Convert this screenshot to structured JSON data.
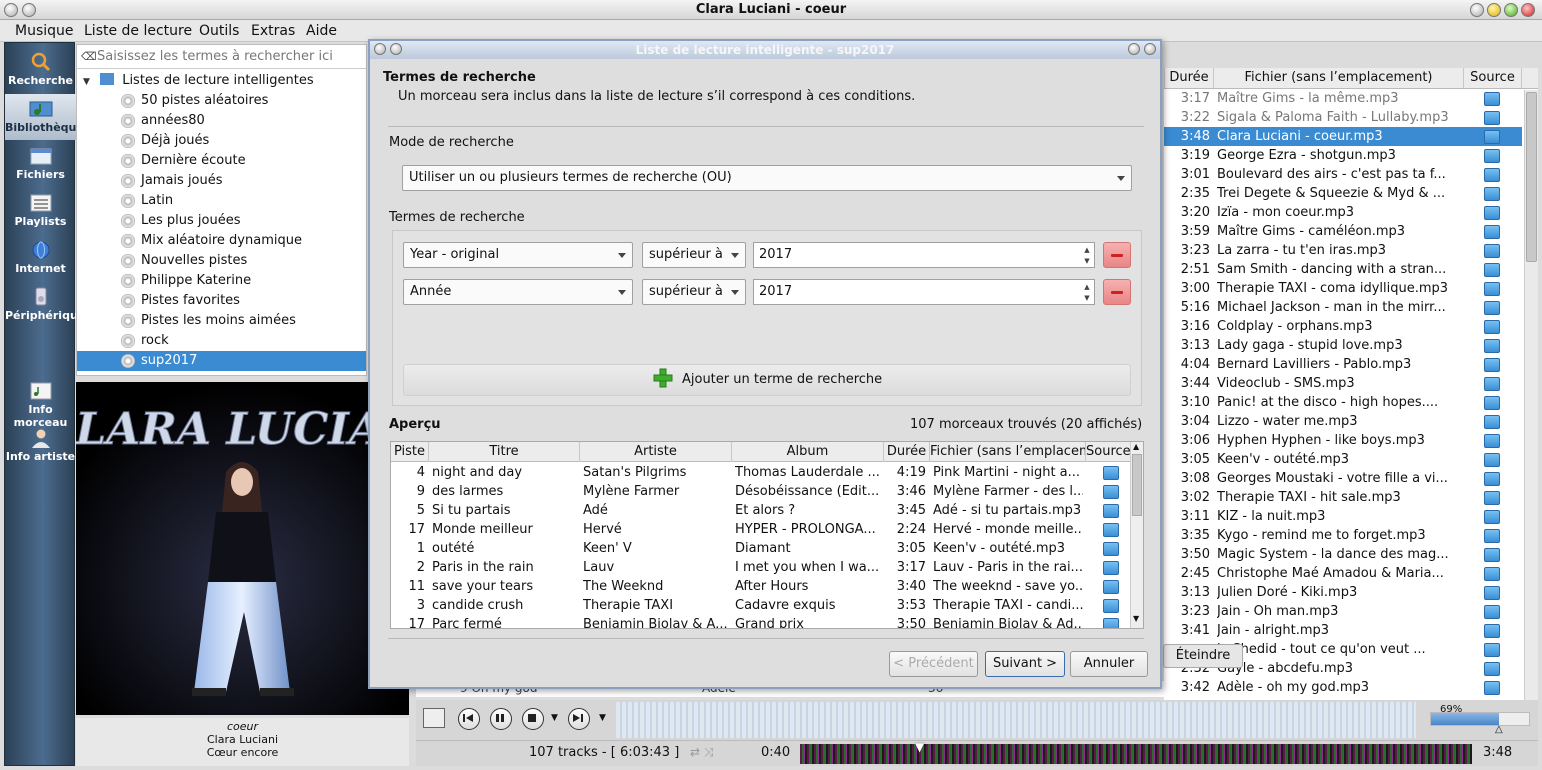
{
  "window": {
    "title": "Clara Luciani - coeur"
  },
  "menu": [
    "Musique",
    "Liste de lecture",
    "Outils",
    "Extras",
    "Aide"
  ],
  "nav": [
    {
      "label": "Recherche",
      "icon": "search-icon"
    },
    {
      "label": "Bibliothèque",
      "icon": "library-icon"
    },
    {
      "label": "Fichiers",
      "icon": "files-icon"
    },
    {
      "label": "Playlists",
      "icon": "playlists-icon"
    },
    {
      "label": "Internet",
      "icon": "internet-icon"
    },
    {
      "label": "Périphériques",
      "icon": "devices-icon"
    },
    {
      "label": "Info morceau",
      "icon": "track-info-icon"
    },
    {
      "label": "Info artiste",
      "icon": "artist-info-icon"
    }
  ],
  "search": {
    "placeholder": "Saisissez les termes à rechercher ici"
  },
  "tree": {
    "root": "Listes de lecture intelligentes",
    "items": [
      "50 pistes aléatoires",
      "années80",
      "Déjà joués",
      "Dernière écoute",
      "Jamais joués",
      "Latin",
      "Les plus jouées",
      "Mix aléatoire dynamique",
      "Nouvelles pistes",
      "Philippe Katerine",
      "Pistes favorites",
      "Pistes les moins aimées",
      "rock",
      "sup2017"
    ],
    "selected": "sup2017"
  },
  "album": {
    "art_text": "CLARA LUCIANI",
    "track": "coeur",
    "artist": "Clara Luciani",
    "album": "Cœur encore"
  },
  "playlist": {
    "headers": {
      "duration": "Durée",
      "file": "Fichier (sans l’emplacement)",
      "source": "Source"
    },
    "rows": [
      {
        "d": "3:17",
        "f": "Maître Gims - la même.mp3",
        "s": "gray"
      },
      {
        "d": "3:22",
        "f": "Sigala & Paloma Faith - Lullaby.mp3",
        "s": "gray"
      },
      {
        "d": "3:48",
        "f": "Clara Luciani - coeur.mp3",
        "s": "sel"
      },
      {
        "d": "3:19",
        "f": "George Ezra - shotgun.mp3",
        "s": ""
      },
      {
        "d": "3:01",
        "f": "Boulevard des airs - c'est pas ta f...",
        "s": ""
      },
      {
        "d": "2:35",
        "f": "Trei Degete & Squeezie & Myd & ...",
        "s": ""
      },
      {
        "d": "3:20",
        "f": "Izïa - mon coeur.mp3",
        "s": ""
      },
      {
        "d": "3:59",
        "f": "Maître Gims - caméléon.mp3",
        "s": ""
      },
      {
        "d": "3:23",
        "f": "La zarra - tu t'en iras.mp3",
        "s": ""
      },
      {
        "d": "2:51",
        "f": "Sam Smith - dancing with a stran...",
        "s": ""
      },
      {
        "d": "3:00",
        "f": "Therapie TAXI - coma idyllique.mp3",
        "s": ""
      },
      {
        "d": "5:16",
        "f": "Michael Jackson - man in the mirr...",
        "s": ""
      },
      {
        "d": "3:16",
        "f": "Coldplay - orphans.mp3",
        "s": ""
      },
      {
        "d": "3:13",
        "f": "Lady gaga - stupid love.mp3",
        "s": ""
      },
      {
        "d": "4:04",
        "f": "Bernard Lavilliers - Pablo.mp3",
        "s": ""
      },
      {
        "d": "3:44",
        "f": "Videoclub - SMS.mp3",
        "s": ""
      },
      {
        "d": "3:10",
        "f": "Panic! at the disco - high hopes....",
        "s": ""
      },
      {
        "d": "3:04",
        "f": "Lizzo - water me.mp3",
        "s": ""
      },
      {
        "d": "3:06",
        "f": "Hyphen Hyphen - like boys.mp3",
        "s": ""
      },
      {
        "d": "3:05",
        "f": "Keen'v - outété.mp3",
        "s": ""
      },
      {
        "d": "3:08",
        "f": "Georges Moustaki - votre fille a vi...",
        "s": ""
      },
      {
        "d": "3:02",
        "f": "Therapie TAXI - hit sale.mp3",
        "s": ""
      },
      {
        "d": "3:11",
        "f": "KIZ - la nuit.mp3",
        "s": ""
      },
      {
        "d": "3:35",
        "f": "Kygo - remind me to forget.mp3",
        "s": ""
      },
      {
        "d": "3:50",
        "f": "Magic System - la dance des mag...",
        "s": ""
      },
      {
        "d": "2:45",
        "f": "Christophe Maé Amadou & Maria...",
        "s": ""
      },
      {
        "d": "3:13",
        "f": "Julien Doré - Kiki.mp3",
        "s": ""
      },
      {
        "d": "3:23",
        "f": "Jain - Oh man.mp3",
        "s": ""
      },
      {
        "d": "3:41",
        "f": "Jain - alright.mp3",
        "s": ""
      },
      {
        "d": "",
        "f": "is Chedid - tout ce qu'on veut ...",
        "s": ""
      },
      {
        "d": "2:32",
        "f": "Gayle - abcdefu.mp3",
        "s": ""
      },
      {
        "d": "3:42",
        "f": "Adèle - oh my god.mp3",
        "s": ""
      }
    ]
  },
  "behind": {
    "shutdown": "Éteindre",
    "partial_row": "9  Oh my god",
    "partial_artist": "Adele",
    "partial_dur": "36"
  },
  "controls": {
    "volume": "69%",
    "volume_level": 0.69
  },
  "status": {
    "tracks": "107 tracks - [ 6:03:43 ]",
    "elapsed": "0:40",
    "total": "3:48",
    "progress": 0.18
  },
  "dialog": {
    "title": "Liste de lecture intelligente - sup2017",
    "heading": "Termes de recherche",
    "subtitle": "Un morceau sera inclus dans la liste de lecture s’il correspond à ces conditions.",
    "mode_label": "Mode de recherche",
    "mode_value": "Utiliser un ou plusieurs termes de recherche (OU)",
    "terms_label": "Termes de recherche",
    "terms": [
      {
        "field": "Year - original",
        "op": "supérieur à",
        "value": "2017"
      },
      {
        "field": "Année",
        "op": "supérieur à",
        "value": "2017"
      }
    ],
    "add_term": "Ajouter un terme de recherche",
    "preview_label": "Aperçu",
    "found": "107 morceaux trouvés (20 affichés)",
    "preview_headers": [
      "Piste",
      "Titre",
      "Artiste",
      "Album",
      "Durée",
      "Fichier (sans l’emplacement)",
      "Source"
    ],
    "preview_rows": [
      [
        "4",
        "night and day",
        "Satan's Pilgrims",
        "Thomas Lauderdale ...",
        "4:19",
        "Pink Martini - night a..."
      ],
      [
        "9",
        "des larmes",
        "Mylène Farmer",
        "Désobéissance (Edit...",
        "3:46",
        "Mylène Farmer - des l..."
      ],
      [
        "5",
        "Si tu partais",
        "Adé",
        "Et alors ?",
        "3:45",
        "Adé - si tu partais.mp3"
      ],
      [
        "17",
        "Monde meilleur",
        "Hervé",
        "HYPER - PROLONGA...",
        "2:24",
        "Hervé - monde meille..."
      ],
      [
        "1",
        "outété",
        "Keen' V",
        "Diamant",
        "3:05",
        "Keen'v - outété.mp3"
      ],
      [
        "2",
        "Paris in the rain",
        "Lauv",
        "I met you when I wa...",
        "3:17",
        "Lauv - Paris in the rai..."
      ],
      [
        "11",
        "save your tears",
        "The Weeknd",
        "After Hours",
        "3:40",
        "The weeknd - save yo..."
      ],
      [
        "3",
        "candide crush",
        "Therapie TAXI",
        "Cadavre exquis",
        "3:53",
        "Therapie TAXI - candi..."
      ],
      [
        "17",
        "Parc fermé",
        "Benjamin Biolay & A...",
        "Grand prix",
        "3:50",
        "Benjamin Biolay & Ad..."
      ]
    ],
    "btn_prev": "< Précédent",
    "btn_next": "Suivant >",
    "btn_cancel": "Annuler"
  }
}
